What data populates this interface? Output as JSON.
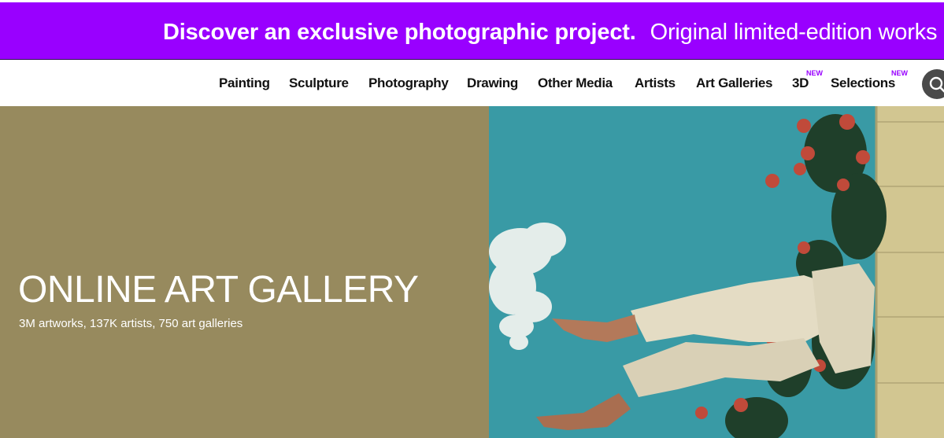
{
  "promo": {
    "bold_text": "Discover an exclusive photographic project.",
    "text": "Original limited-edition works",
    "background": "#9900ff"
  },
  "nav": {
    "items": [
      {
        "label": "Painting"
      },
      {
        "label": "Sculpture"
      },
      {
        "label": "Photography"
      },
      {
        "label": "Drawing"
      },
      {
        "label": "Other Media"
      },
      {
        "label": "Artists"
      },
      {
        "label": "Art Galleries"
      },
      {
        "label": "3D",
        "badge": "NEW"
      },
      {
        "label": "Selections",
        "badge": "NEW"
      }
    ],
    "search_icon": "search-icon"
  },
  "hero": {
    "title": "ONLINE ART GALLERY",
    "subtitle": "3M artworks, 137K artists, 750 art galleries",
    "background": "#978a5e"
  }
}
